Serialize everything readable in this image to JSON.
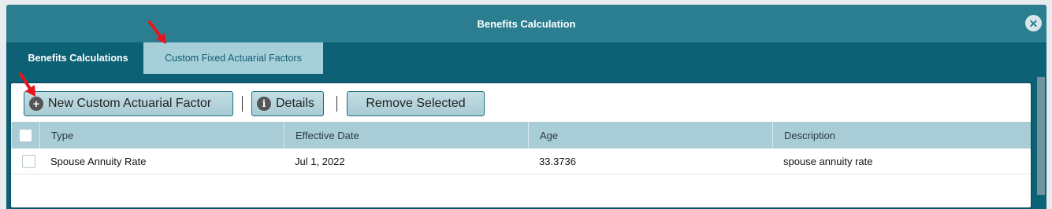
{
  "dialog": {
    "title": "Benefits Calculation",
    "close_icon": "close-circle-icon"
  },
  "tabs": [
    {
      "label": "Benefits Calculations",
      "active": false
    },
    {
      "label": "Custom Fixed Actuarial Factors",
      "active": true
    }
  ],
  "toolbar": {
    "new_label": "New Custom Actuarial Factor",
    "new_icon": "plus-circle-icon",
    "details_label": "Details",
    "details_icon": "info-circle-icon",
    "remove_label": "Remove Selected"
  },
  "grid": {
    "columns": [
      "Type",
      "Effective Date",
      "Age",
      "Description"
    ],
    "rows": [
      {
        "type": "Spouse Annuity Rate",
        "effective_date": "Jul 1, 2022",
        "age": "33.3736",
        "description": "spouse annuity rate"
      }
    ]
  },
  "colors": {
    "header": "#2a7e8f",
    "tabbar": "#0d6175",
    "active_tab": "#a7cfd9",
    "annotation_arrow": "#e8141c"
  }
}
